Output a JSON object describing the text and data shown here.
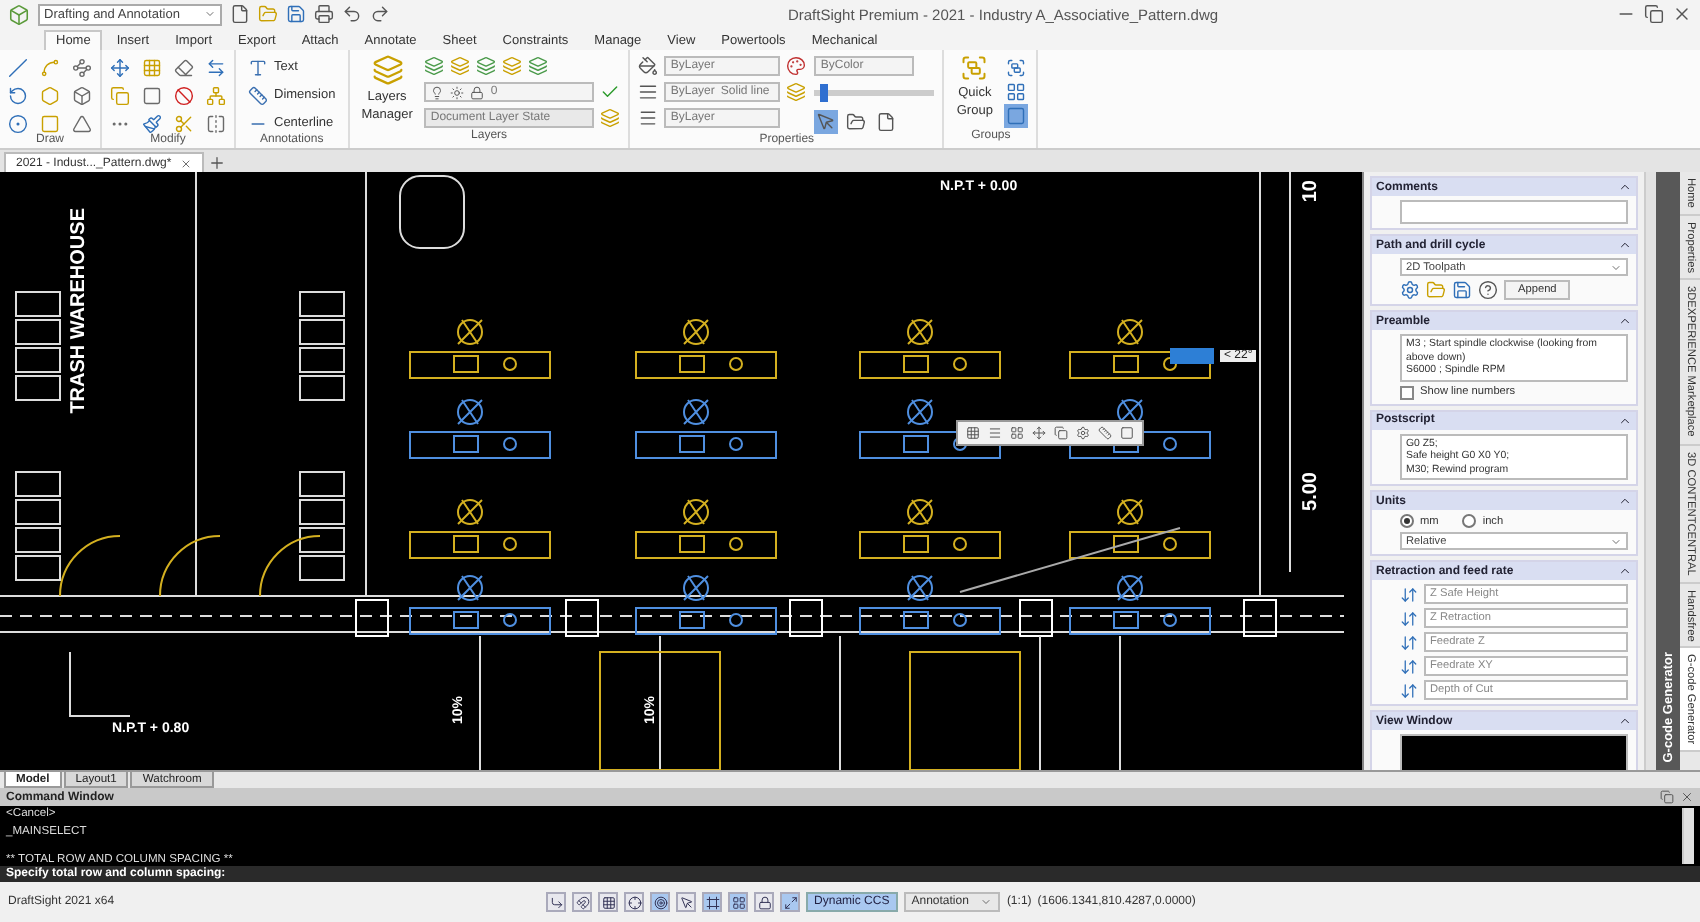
{
  "title_bar": {
    "workspace": "Drafting and Annotation",
    "title": "DraftSight Premium - 2021 - Industry A_Associative_Pattern.dwg"
  },
  "ribbon_tabs": [
    {
      "label": "Home",
      "selected": true
    },
    {
      "label": "Insert",
      "selected": false
    },
    {
      "label": "Import",
      "selected": false
    },
    {
      "label": "Export",
      "selected": false
    },
    {
      "label": "Attach",
      "selected": false
    },
    {
      "label": "Annotate",
      "selected": false
    },
    {
      "label": "Sheet",
      "selected": false
    },
    {
      "label": "Constraints",
      "selected": false
    },
    {
      "label": "Manage",
      "selected": false
    },
    {
      "label": "View",
      "selected": false
    },
    {
      "label": "Powertools",
      "selected": false
    },
    {
      "label": "Mechanical",
      "selected": false
    }
  ],
  "ribbon_groups": [
    {
      "kind": "draw",
      "label": "Draw"
    },
    {
      "kind": "modify",
      "label": "Modify"
    },
    {
      "kind": "annotations",
      "label": "Annotations",
      "items": [
        "Text",
        "Dimension",
        "Centerline"
      ]
    },
    {
      "kind": "layers",
      "label": "Layers",
      "manager": "Layers Manager",
      "layer": "0",
      "layer_state": "Document Layer State"
    },
    {
      "kind": "properties",
      "label": "Properties",
      "color_value": "ByLayer",
      "linetype": "ByLayer",
      "linestyle": "Solid line",
      "lineweight": "ByLayer",
      "plot_style": "ByColor",
      "level": 0.05,
      "toggles": [
        {
          "on": true
        },
        {
          "on": false
        },
        {
          "on": false
        }
      ]
    },
    {
      "kind": "groups",
      "label": "Groups",
      "button": "Quick Group",
      "toggles": [
        {
          "on": false
        },
        {
          "on": false
        },
        {
          "on": true
        }
      ]
    }
  ],
  "document_tabs": [
    {
      "label": "2021 - Indust..._Pattern.dwg*",
      "selected": true
    }
  ],
  "drawing": {
    "building": "TRASH WAREHOUSE",
    "levels": [
      "N.P.T + 0.00",
      "N.P.T + 0.80"
    ],
    "dimension": "5.00",
    "edge_dimension": "10",
    "slopes": [
      "10%",
      "10%"
    ],
    "angle_tooltip": "< 22°"
  },
  "layout_tabs": [
    {
      "label": "Model",
      "selected": true
    },
    {
      "label": "Layout1",
      "selected": false
    },
    {
      "label": "Watchroom",
      "selected": false
    }
  ],
  "panel": {
    "label": "G-code Generator",
    "sections": [
      {
        "kind": "comments",
        "title": "Comments"
      },
      {
        "kind": "path",
        "title": "Path and drill cycle",
        "select": "2D Toolpath",
        "button": "Append"
      },
      {
        "kind": "script",
        "title": "Preamble",
        "lines": [
          "M3    ; Start spindle clockwise (looking from above down)",
          "S6000 ; Spindle RPM"
        ],
        "checkbox": {
          "label": "Show line numbers",
          "checked": false
        }
      },
      {
        "kind": "script",
        "title": "Postscript",
        "lines": [
          "G0 Z5;",
          "Safe height G0 X0 Y0;",
          "M30; Rewind program"
        ]
      },
      {
        "kind": "units",
        "title": "Units",
        "options": [
          {
            "label": "mm",
            "selected": true
          },
          {
            "label": "inch",
            "selected": false
          }
        ],
        "select": "Relative"
      },
      {
        "kind": "fields",
        "title": "Retraction and feed rate",
        "fields": [
          {
            "placeholder": "Z Safe Height"
          },
          {
            "placeholder": "Z Retraction"
          },
          {
            "placeholder": "Feedrate Z"
          },
          {
            "placeholder": "Feedrate XY"
          },
          {
            "placeholder": "Depth of Cut"
          }
        ]
      },
      {
        "kind": "view",
        "title": "View Window"
      }
    ]
  },
  "side_tabs": [
    {
      "label": "Home",
      "selected": false
    },
    {
      "label": "Properties",
      "selected": false
    },
    {
      "label": "3DEXPERIENCE Marketplace",
      "selected": false
    },
    {
      "label": "3D CONTENTCENTRAL",
      "selected": false
    },
    {
      "label": "Handsfree",
      "selected": false
    },
    {
      "label": "G-code Generator",
      "selected": true
    }
  ],
  "command_window": {
    "title": "Command Window",
    "history": [
      "<Cancel>",
      "_MAINSELECT",
      "** TOTAL ROW AND COLUMN SPACING **"
    ],
    "prompt": "Specify total row and column spacing:"
  },
  "status_bar": {
    "app": "DraftSight 2021 x64",
    "toggles": [
      {
        "on": false
      },
      {
        "on": false
      },
      {
        "on": false
      },
      {
        "on": false
      },
      {
        "on": true
      },
      {
        "on": false
      },
      {
        "on": true
      },
      {
        "on": true
      },
      {
        "on": false
      },
      {
        "on": true
      }
    ],
    "dynamic_ccs": {
      "label": "Dynamic CCS",
      "on": true
    },
    "annotation": "Annotation",
    "scale": "(1:1)",
    "coordinates": "(1606.1341,810.4287,0.0000)"
  }
}
